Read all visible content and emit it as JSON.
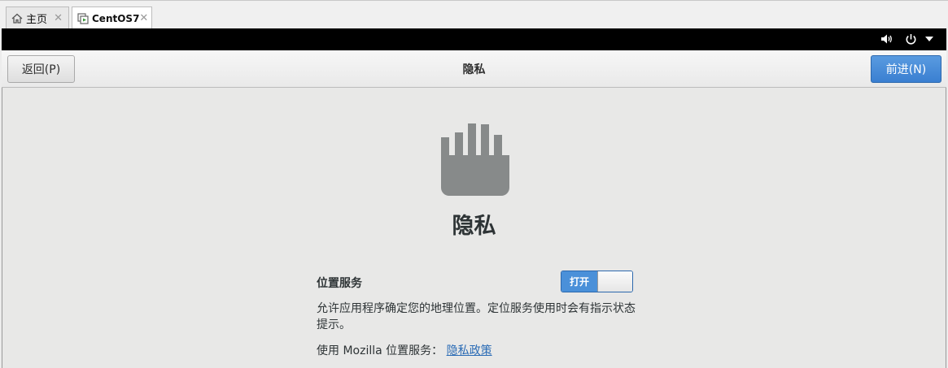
{
  "vm_tabs": [
    {
      "label": "主页",
      "icon": "home-icon"
    },
    {
      "label": "CentOS7",
      "icon": "vm-icon"
    }
  ],
  "header": {
    "back_label": "返回(P)",
    "title": "隐私",
    "next_label": "前进(N)"
  },
  "main": {
    "icon": "hand-icon",
    "title": "隐私",
    "location_label": "位置服务",
    "switch_label": "打开",
    "switch_state": "on",
    "description": "允许应用程序确定您的地理位置。定位服务使用时会有指示状态提示。",
    "mozilla_text": "使用 Mozilla 位置服务：",
    "privacy_link": "隐私政策"
  },
  "colors": {
    "accent": "#4a90d9",
    "link": "#2a6bb5",
    "topbar": "#000000"
  }
}
